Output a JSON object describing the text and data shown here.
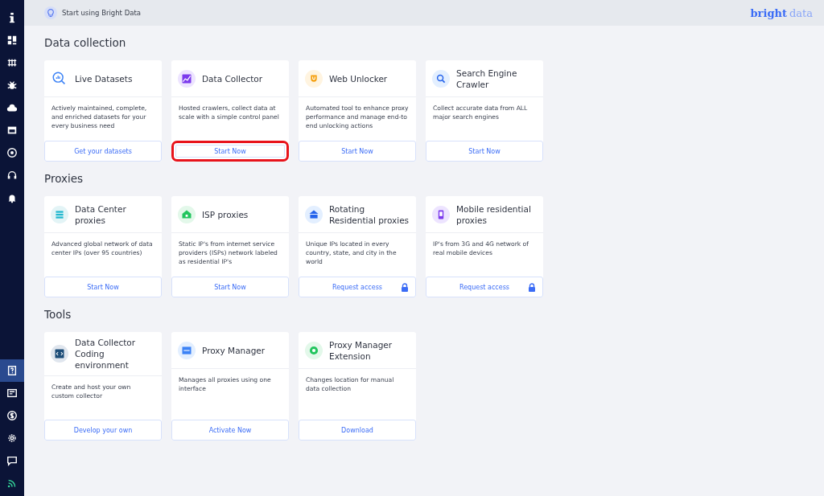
{
  "sidebar": {
    "top_items": [
      {
        "kind": "info",
        "selected": false
      },
      {
        "kind": "dashboard",
        "selected": false
      },
      {
        "kind": "network",
        "selected": false
      },
      {
        "kind": "bug",
        "selected": false
      },
      {
        "kind": "cloud",
        "selected": false
      },
      {
        "kind": "pm",
        "selected": false
      },
      {
        "kind": "chrome",
        "selected": false
      },
      {
        "kind": "support",
        "selected": false
      },
      {
        "kind": "bell",
        "selected": false
      }
    ],
    "bottom_items": [
      {
        "kind": "help",
        "selected": true
      },
      {
        "kind": "billing-doc",
        "selected": false
      },
      {
        "kind": "dollar",
        "selected": false
      },
      {
        "kind": "gear",
        "selected": false
      },
      {
        "kind": "chat",
        "selected": false
      },
      {
        "kind": "feed",
        "selected": false
      }
    ]
  },
  "top_bar": {
    "title": "Start using Bright Data",
    "logo": {
      "bold": "bright",
      "light": "data"
    }
  },
  "sections": [
    {
      "title": "Data collection",
      "cards": [
        {
          "kind": "chart-search",
          "title": "Live Datasets",
          "description": "Actively maintained, complete, and enriched datasets for your every business need",
          "action": "Get your datasets",
          "locked": false,
          "highlighted": false
        },
        {
          "kind": "chart-line",
          "title": "Data Collector",
          "description": "Hosted crawlers, collect data at scale with a simple control panel",
          "action": "Start Now",
          "locked": false,
          "highlighted": true
        },
        {
          "kind": "shield",
          "title": "Web Unlocker",
          "description": "Automated tool to enhance proxy performance and manage end-to end unlocking actions",
          "action": "Start Now",
          "locked": false,
          "highlighted": false
        },
        {
          "kind": "search",
          "title": "Search Engine Crawler",
          "description": "Collect accurate data from ALL major search engines",
          "action": "Start Now",
          "locked": false,
          "highlighted": false
        }
      ]
    },
    {
      "title": "Proxies",
      "cards": [
        {
          "kind": "server",
          "title": "Data Center proxies",
          "description": "Advanced global network of data center IPs (over 95 countries)",
          "action": "Start Now",
          "locked": false,
          "highlighted": false
        },
        {
          "kind": "house-green",
          "title": "ISP proxies",
          "description": "Static IP's from internet service providers (ISPs) network labeled as residential IP's",
          "action": "Start Now",
          "locked": false,
          "highlighted": false
        },
        {
          "kind": "house-blue",
          "title": "Rotating Residential proxies",
          "description": "Unique IPs located in every country, state, and city in the world",
          "action": "Request access",
          "locked": true,
          "highlighted": false
        },
        {
          "kind": "phone",
          "title": "Mobile residential proxies",
          "description": "IP's from 3G and 4G network of real mobile devices",
          "action": "Request access",
          "locked": true,
          "highlighted": false
        }
      ]
    },
    {
      "title": "Tools",
      "cards": [
        {
          "kind": "code",
          "title": "Data Collector Coding environment",
          "description": "Create and host your own custom collector",
          "action": "Develop your own",
          "locked": false,
          "highlighted": false
        },
        {
          "kind": "window",
          "title": "Proxy Manager",
          "description": "Manages all proxies using one interface",
          "action": "Activate Now",
          "locked": false,
          "highlighted": false
        },
        {
          "kind": "chrome",
          "title": "Proxy Manager Extension",
          "description": "Changes location for manual data collection",
          "action": "Download",
          "locked": false,
          "highlighted": false
        }
      ]
    }
  ]
}
